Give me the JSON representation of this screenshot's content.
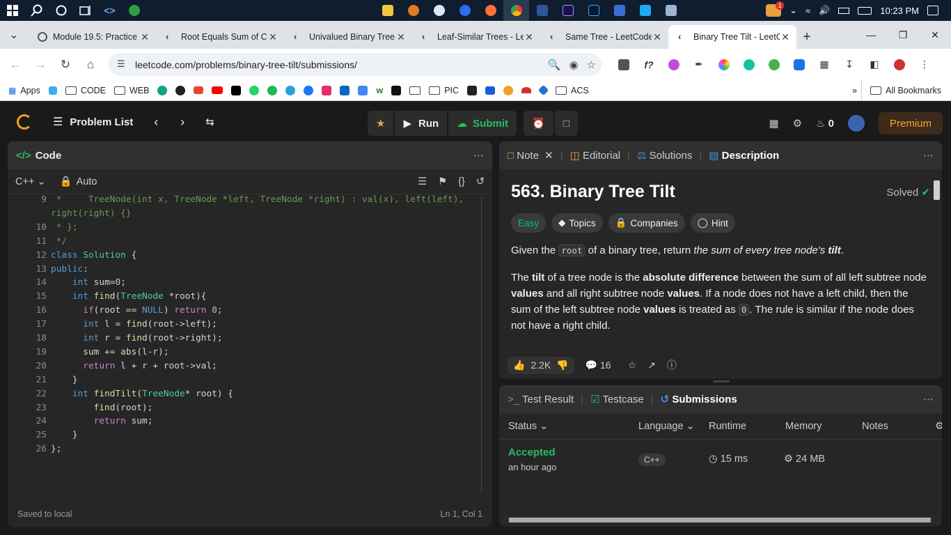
{
  "taskbar": {
    "clock": "10:23 PM",
    "badge": "1"
  },
  "tabs": [
    {
      "title": "Module 19.5: Practice"
    },
    {
      "title": "Root Equals Sum of Children"
    },
    {
      "title": "Univalued Binary Tree"
    },
    {
      "title": "Leaf-Similar Trees - LeetCode"
    },
    {
      "title": "Same Tree - LeetCode"
    },
    {
      "title": "Binary Tree Tilt - LeetCode"
    }
  ],
  "address": {
    "url": "leetcode.com/problems/binary-tree-tilt/submissions/"
  },
  "bookmarks": {
    "apps": "Apps",
    "code": "CODE",
    "web": "WEB",
    "pic": "PIC",
    "acs": "ACS",
    "all": "All Bookmarks"
  },
  "lc": {
    "problem_list": "Problem List",
    "run": "Run",
    "submit": "Submit",
    "streak": "0",
    "premium": "Premium"
  },
  "code": {
    "title": "Code",
    "lang": "C++",
    "mode": "Auto",
    "saved": "Saved to local",
    "cursor": "Ln 1, Col 1",
    "lines": [
      {
        "n": "9",
        "t": " *     TreeNode(int x, TreeNode *left, TreeNode *right) : val(x), left(left),"
      },
      {
        "n": "",
        "t": "right(right) {}"
      },
      {
        "n": "10",
        "t": " * };"
      },
      {
        "n": "11",
        "t": " */"
      },
      {
        "n": "12",
        "t": "class Solution {"
      },
      {
        "n": "13",
        "t": "public:"
      },
      {
        "n": "14",
        "t": "    int sum=0;"
      },
      {
        "n": "15",
        "t": "    int find(TreeNode *root){"
      },
      {
        "n": "16",
        "t": "      if(root == NULL) return 0;"
      },
      {
        "n": "17",
        "t": "      int l = find(root->left);"
      },
      {
        "n": "18",
        "t": "      int r = find(root->right);"
      },
      {
        "n": "19",
        "t": "      sum += abs(l-r);"
      },
      {
        "n": "20",
        "t": "      return l + r + root->val;"
      },
      {
        "n": "21",
        "t": "    }"
      },
      {
        "n": "22",
        "t": "    int findTilt(TreeNode* root) {"
      },
      {
        "n": "23",
        "t": "        find(root);"
      },
      {
        "n": "24",
        "t": "        return sum;"
      },
      {
        "n": "25",
        "t": "    }"
      },
      {
        "n": "26",
        "t": "};"
      }
    ]
  },
  "desc": {
    "tab_note": "Note",
    "tab_editorial": "Editorial",
    "tab_solutions": "Solutions",
    "tab_description": "Description",
    "title": "563. Binary Tree Tilt",
    "solved": "Solved",
    "chip_easy": "Easy",
    "chip_topics": "Topics",
    "chip_companies": "Companies",
    "chip_hint": "Hint",
    "p1_a": "Given the ",
    "p1_code": "root",
    "p1_b": " of a binary tree, return ",
    "p1_c": "the sum of every tree node's ",
    "p1_d": "tilt",
    "p1_e": ".",
    "p2_a": "The ",
    "p2_b": "tilt",
    "p2_c": " of a tree node is the ",
    "p2_d": "absolute difference",
    "p2_e": " between the sum of all left subtree node ",
    "p2_f": "values",
    "p2_g": " and all right subtree node ",
    "p2_h": "values",
    "p2_i": ". If a node does not have a left child, then the sum of the left subtree node ",
    "p2_j": "values",
    "p2_k": " is treated as ",
    "p2_code": "0",
    "p2_l": ". The rule is similar if the node does not have a right child.",
    "likes": "2.2K",
    "comments": "16"
  },
  "results": {
    "tab_result": "Test Result",
    "tab_testcase": "Testcase",
    "tab_submissions": "Submissions",
    "col_status": "Status",
    "col_language": "Language",
    "col_runtime": "Runtime",
    "col_memory": "Memory",
    "col_notes": "Notes",
    "row_status": "Accepted",
    "row_time": "an hour ago",
    "row_lang": "C++",
    "row_runtime": "15 ms",
    "row_memory": "24 MB"
  },
  "colors": {
    "accepted": "#2cbb5d",
    "easy": "#00b8a3",
    "premium": "#f7a531",
    "submit": "#2cbb5d"
  }
}
